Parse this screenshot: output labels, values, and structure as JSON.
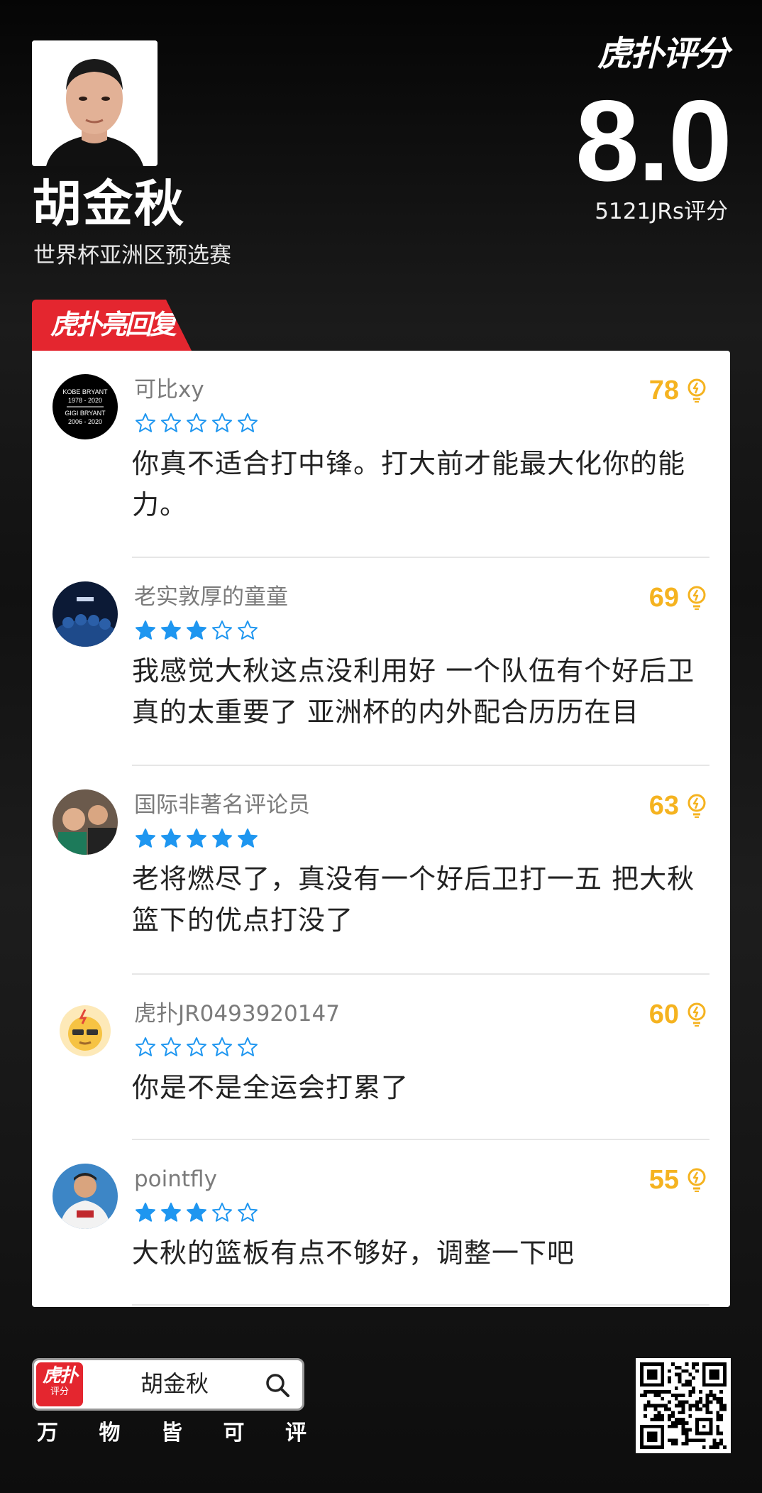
{
  "player": {
    "name": "胡金秋",
    "event": "世界杯亚洲区预选赛"
  },
  "rating": {
    "brand": "虎扑评分",
    "score": "8.0",
    "count_label": "5121JRs评分"
  },
  "section": {
    "title": "虎扑亮回复"
  },
  "colors": {
    "accent": "#e4262f",
    "star": "#1e96f0",
    "likes": "#f5b320"
  },
  "comments": [
    {
      "user": "可比xy",
      "stars": 0,
      "likes": "78",
      "text": "你真不适合打中锋。打大前才能最大化你的能力。",
      "avatar_text": [
        "KOBE BRYANT",
        "1978 - 2020",
        "GIGI BRYANT",
        "2006 - 2020"
      ]
    },
    {
      "user": "老实敦厚的童童",
      "stars": 3,
      "likes": "69",
      "text": "我感觉大秋这点没利用好 一个队伍有个好后卫真的太重要了 亚洲杯的内外配合历历在目"
    },
    {
      "user": "国际非著名评论员",
      "stars": 5,
      "likes": "63",
      "text": "老将燃尽了，真没有一个好后卫打一五 把大秋篮下的优点打没了"
    },
    {
      "user": "虎扑JR0493920147",
      "stars": 0,
      "likes": "60",
      "text": "你是不是全运会打累了"
    },
    {
      "user": "pointfly",
      "stars": 3,
      "likes": "55",
      "text": "大秋的篮板有点不够好，调整一下吧"
    }
  ],
  "search": {
    "logo_main": "虎扑",
    "logo_sub": "评分",
    "query": "胡金秋"
  },
  "slogan": [
    "万",
    "物",
    "皆",
    "可",
    "评"
  ]
}
